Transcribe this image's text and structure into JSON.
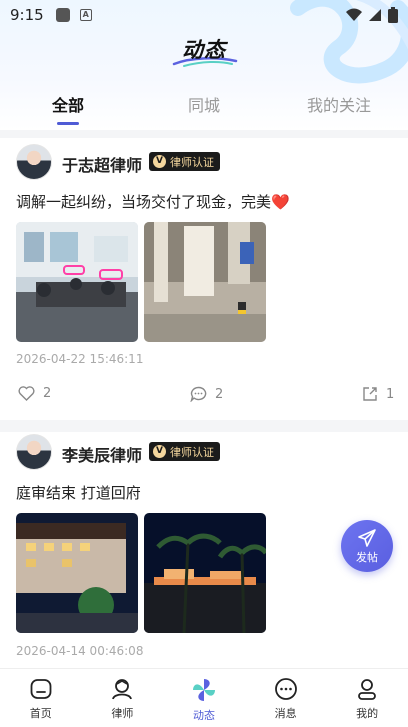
{
  "status_bar": {
    "time": "9:15"
  },
  "header": {
    "title": "动态"
  },
  "tabs": [
    {
      "label": "全部",
      "active": true
    },
    {
      "label": "同城",
      "active": false
    },
    {
      "label": "我的关注",
      "active": false
    }
  ],
  "posts": [
    {
      "author": "于志超律师",
      "badge": "律师认证",
      "text": "调解一起纠纷，当场交付了现金，完美",
      "emoji": "❤️",
      "time": "2026-04-22 15:46:11",
      "likes": "2",
      "comments": "2",
      "shares": "1"
    },
    {
      "author": "李美辰律师",
      "badge": "律师认证",
      "text": "庭审结束 打道回府",
      "time": "2026-04-14 00:46:08"
    }
  ],
  "fab": {
    "label": "发帖"
  },
  "bottom_nav": [
    {
      "label": "首页",
      "icon": "home-icon"
    },
    {
      "label": "律师",
      "icon": "lawyer-icon"
    },
    {
      "label": "动态",
      "icon": "pinwheel-icon",
      "active": true
    },
    {
      "label": "消息",
      "icon": "message-icon"
    },
    {
      "label": "我的",
      "icon": "profile-icon"
    }
  ],
  "colors": {
    "accent": "#4f5bd5",
    "badge_bg": "#1b1b1b",
    "badge_text": "#f5d79e"
  }
}
